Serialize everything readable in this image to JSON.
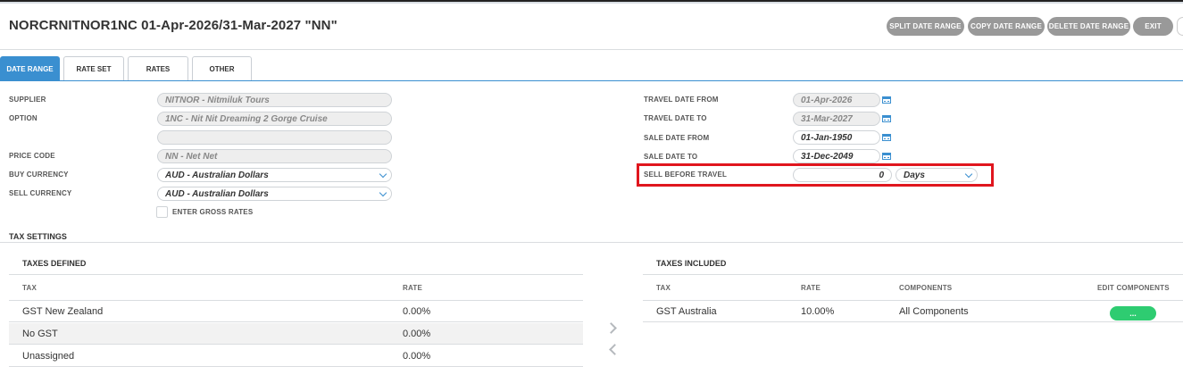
{
  "header": {
    "title": "NORCRNITNOR1NC 01-Apr-2026/31-Mar-2027 \"NN\"",
    "buttons": {
      "split": "SPLIT DATE RANGE",
      "copy": "COPY DATE RANGE",
      "delete": "DELETE DATE RANGE",
      "exit": "EXIT"
    }
  },
  "tabs": [
    {
      "label": "DATE RANGE",
      "active": true
    },
    {
      "label": "RATE SET",
      "active": false
    },
    {
      "label": "RATES",
      "active": false
    },
    {
      "label": "OTHER",
      "active": false
    }
  ],
  "left_form": {
    "supplier": {
      "label": "SUPPLIER",
      "value": "NITNOR - Nitmiluk Tours"
    },
    "option": {
      "label": "OPTION",
      "value": "1NC - Nit Nit Dreaming 2 Gorge Cruise",
      "value2": ""
    },
    "price_code": {
      "label": "PRICE CODE",
      "value": "NN - Net Net"
    },
    "buy_currency": {
      "label": "BUY CURRENCY",
      "value": "AUD - Australian Dollars"
    },
    "sell_currency": {
      "label": "SELL CURRENCY",
      "value": "AUD - Australian Dollars"
    },
    "gross_rates": {
      "label": "ENTER GROSS RATES",
      "checked": false
    }
  },
  "right_form": {
    "travel_from": {
      "label": "TRAVEL DATE FROM",
      "value": "01-Apr-2026"
    },
    "travel_to": {
      "label": "TRAVEL DATE TO",
      "value": "31-Mar-2027"
    },
    "sale_from": {
      "label": "SALE DATE FROM",
      "value": "01-Jan-1950"
    },
    "sale_to": {
      "label": "SALE DATE TO",
      "value": "31-Dec-2049"
    },
    "sell_before": {
      "label": "SELL BEFORE TRAVEL",
      "value": "0",
      "unit": "Days"
    }
  },
  "tax": {
    "section_title": "TAX SETTINGS",
    "defined": {
      "title": "TAXES DEFINED",
      "col_tax": "TAX",
      "col_rate": "RATE",
      "rows": [
        {
          "tax": "GST New Zealand",
          "rate": "0.00%"
        },
        {
          "tax": "No GST",
          "rate": "0.00%"
        },
        {
          "tax": "Unassigned",
          "rate": "0.00%"
        }
      ]
    },
    "included": {
      "title": "TAXES INCLUDED",
      "col_tax": "TAX",
      "col_rate": "RATE",
      "col_components": "COMPONENTS",
      "col_edit": "EDIT COMPONENTS",
      "rows": [
        {
          "tax": "GST Australia",
          "rate": "10.00%",
          "components": "All Components",
          "edit": "..."
        }
      ]
    }
  },
  "colors": {
    "accent": "#3a8fd0",
    "highlight": "#e0161e",
    "button_grey": "#999999",
    "green": "#2ecc71"
  }
}
